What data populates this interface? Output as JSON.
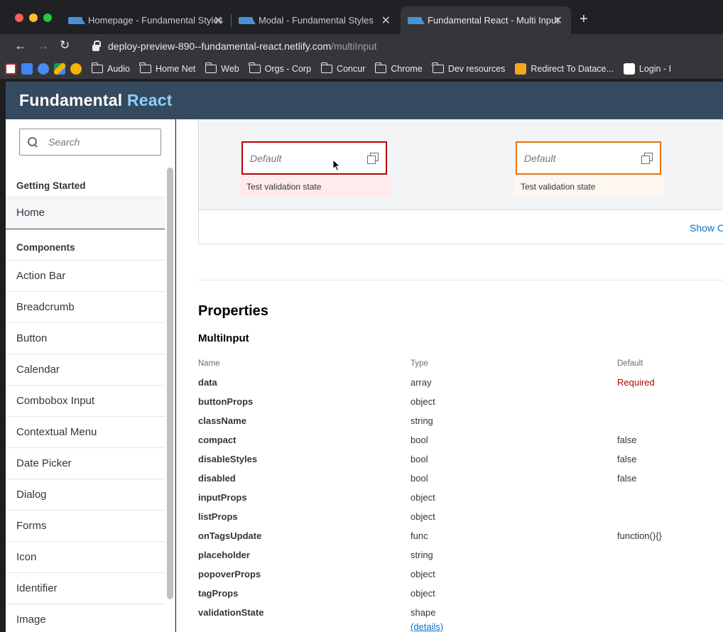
{
  "browser": {
    "tabs": [
      {
        "title": "Homepage - Fundamental Styles",
        "active": false
      },
      {
        "title": "Modal - Fundamental Styles",
        "active": false
      },
      {
        "title": "Fundamental React - Multi Input",
        "active": true
      }
    ],
    "url_host": "deploy-preview-890--fundamental-react.netlify.com",
    "url_path": "/multiInput",
    "bookmarks": [
      "Audio",
      "Home Net",
      "Web",
      "Orgs - Corp",
      "Concur",
      "Chrome",
      "Dev resources",
      "Redirect To Datace...",
      "Login - I"
    ]
  },
  "header": {
    "brand": "Fundamental",
    "brand_accent": "React"
  },
  "sidebar": {
    "search_placeholder": "Search",
    "getting_started": "Getting Started",
    "home": "Home",
    "components": "Components",
    "items": [
      "Action Bar",
      "Breadcrumb",
      "Button",
      "Calendar",
      "Combobox Input",
      "Contextual Menu",
      "Date Picker",
      "Dialog",
      "Forms",
      "Icon",
      "Identifier",
      "Image"
    ]
  },
  "example": {
    "inputs": [
      {
        "placeholder": "Default",
        "message": "Test validation state",
        "state": "error"
      },
      {
        "placeholder": "Default",
        "message": "Test validation state",
        "state": "warning"
      }
    ],
    "show_code": "Show C"
  },
  "properties": {
    "heading": "Properties",
    "component": "MultiInput",
    "columns": [
      "Name",
      "Type",
      "Default"
    ],
    "rows": [
      {
        "name": "data",
        "type": "array",
        "default": "Required"
      },
      {
        "name": "buttonProps",
        "type": "object",
        "default": ""
      },
      {
        "name": "className",
        "type": "string",
        "default": ""
      },
      {
        "name": "compact",
        "type": "bool",
        "default": "false"
      },
      {
        "name": "disableStyles",
        "type": "bool",
        "default": "false"
      },
      {
        "name": "disabled",
        "type": "bool",
        "default": "false"
      },
      {
        "name": "inputProps",
        "type": "object",
        "default": ""
      },
      {
        "name": "listProps",
        "type": "object",
        "default": ""
      },
      {
        "name": "onTagsUpdate",
        "type": "func",
        "default": "function(){}"
      },
      {
        "name": "placeholder",
        "type": "string",
        "default": ""
      },
      {
        "name": "popoverProps",
        "type": "object",
        "default": ""
      },
      {
        "name": "tagProps",
        "type": "object",
        "default": ""
      },
      {
        "name": "validationState",
        "type": "shape",
        "default": ""
      }
    ],
    "details_link": "(details)"
  },
  "colors": {
    "header": "#354a5f",
    "accent": "#89d1ff",
    "error": "#bb0000",
    "warning": "#e9730c",
    "link": "#0a6ed1"
  }
}
